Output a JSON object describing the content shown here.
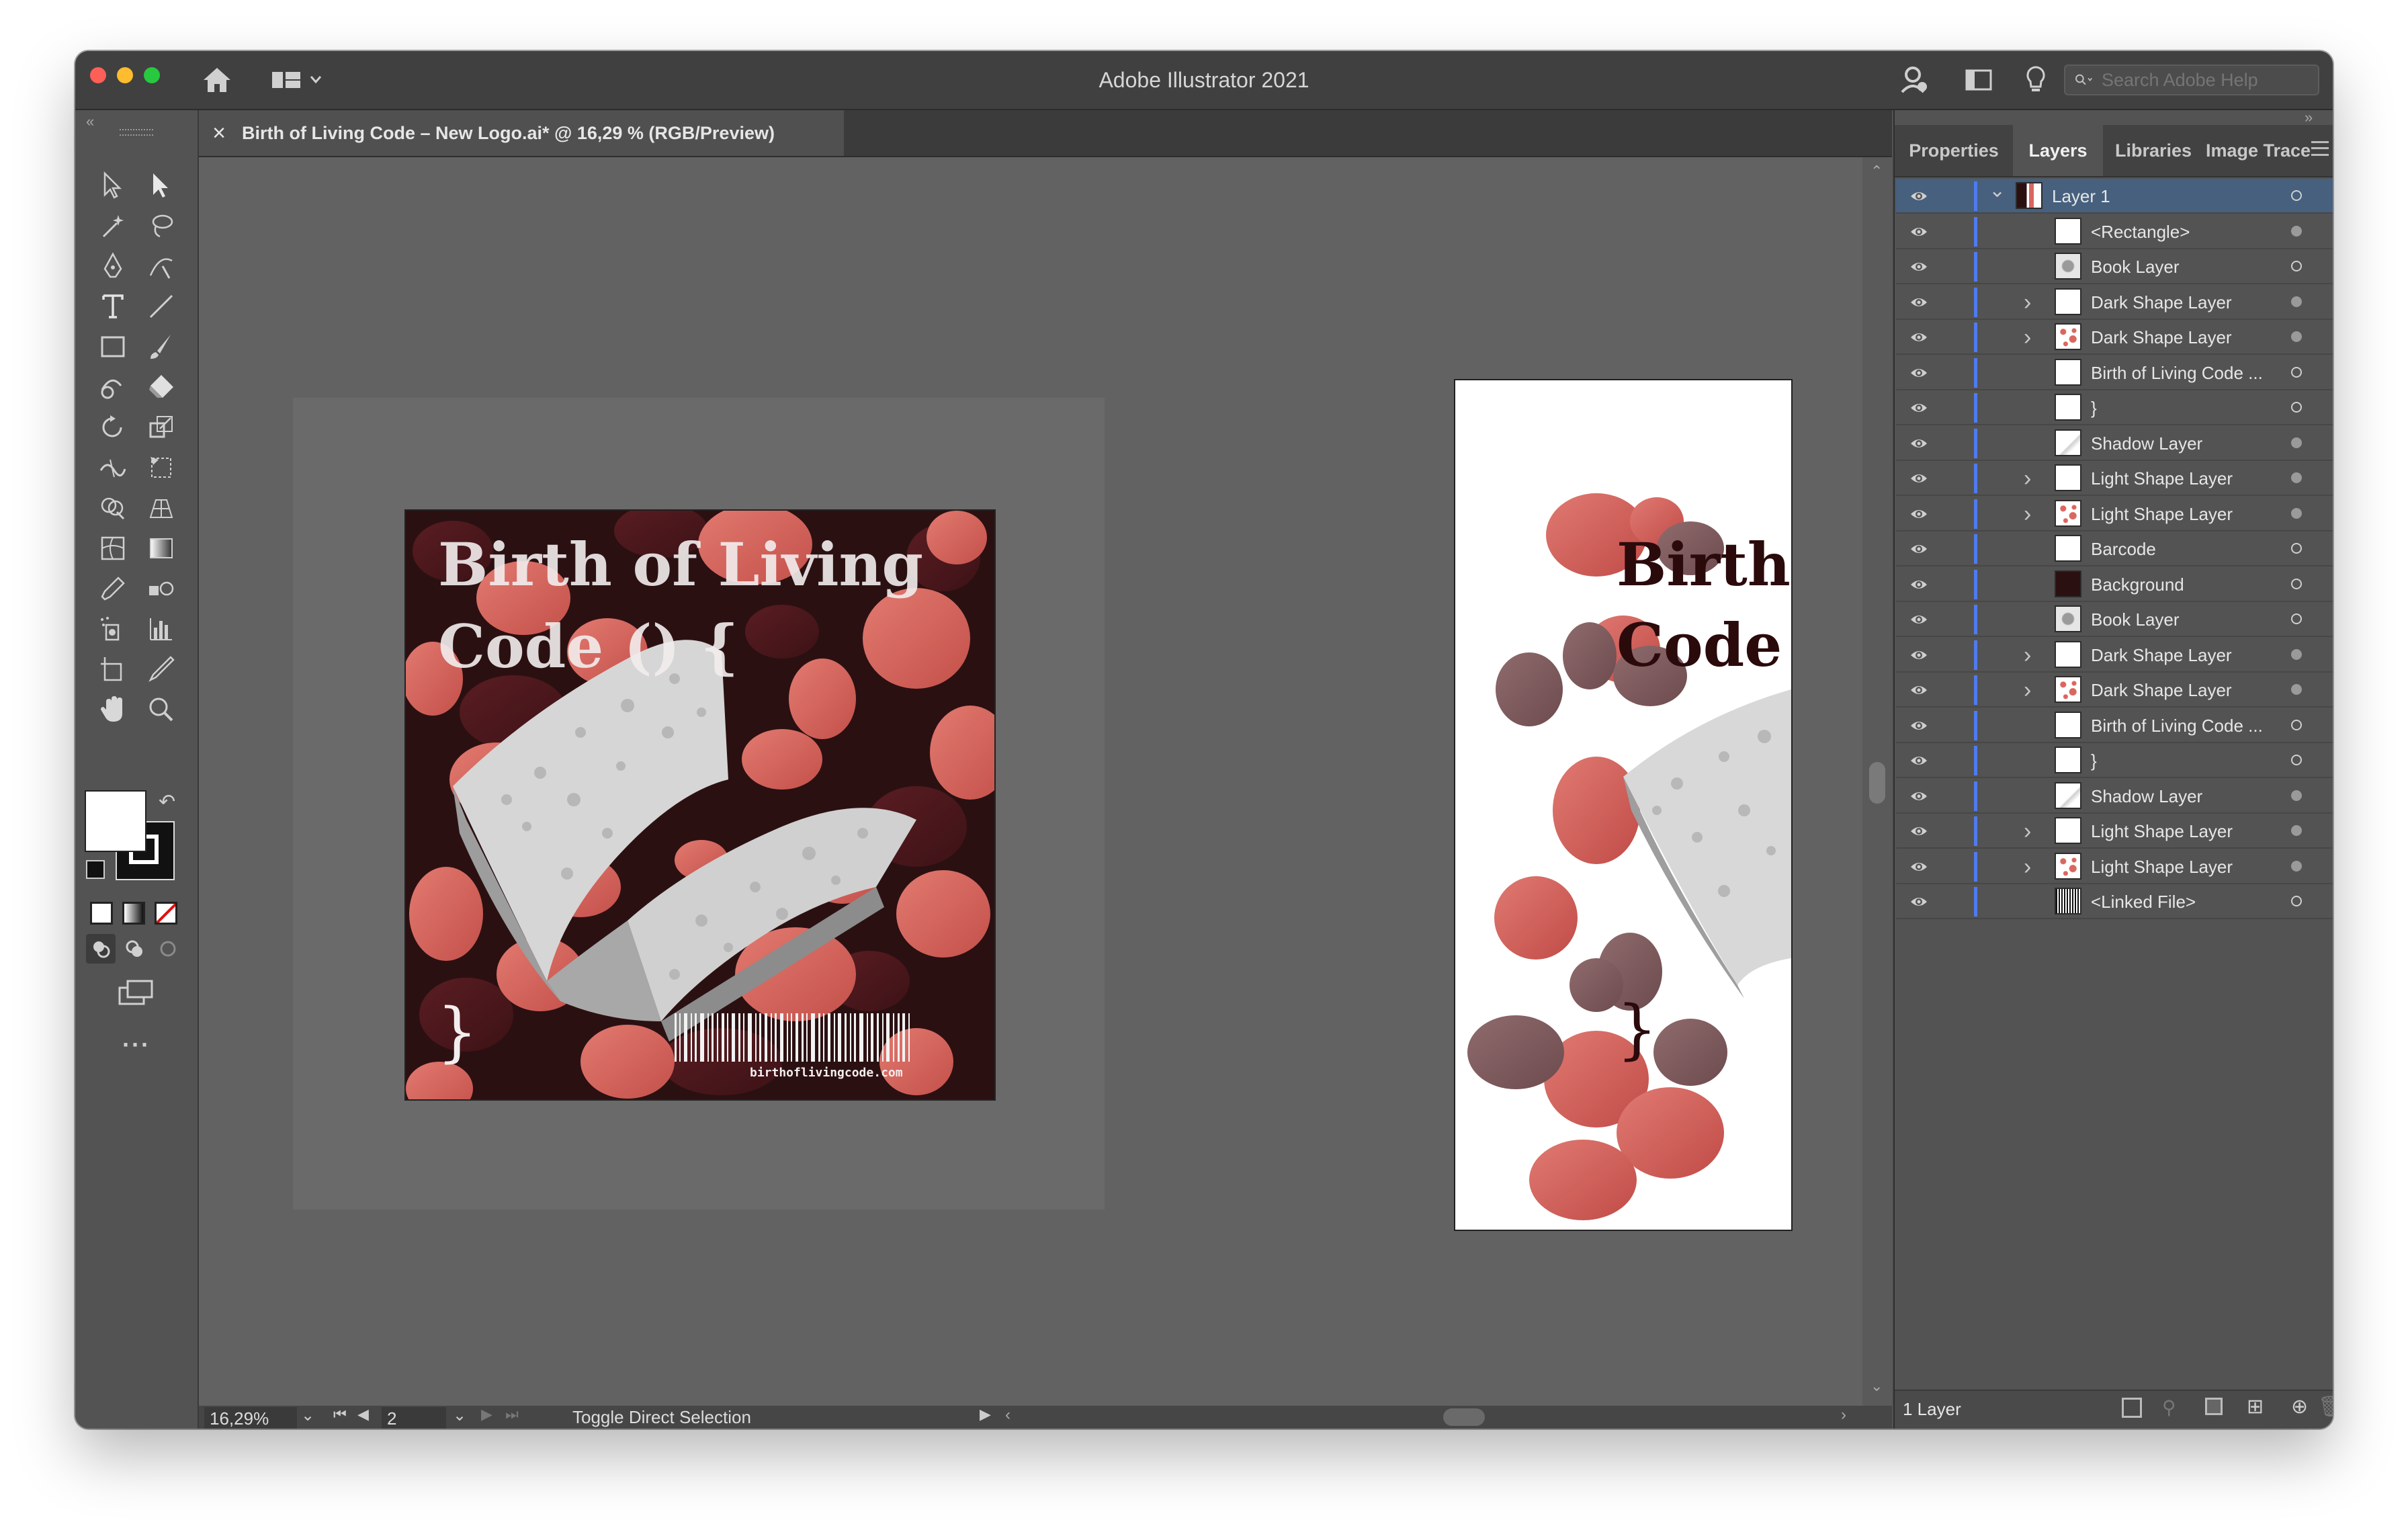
{
  "window": {
    "title": "Adobe Illustrator 2021",
    "traffic_colors": [
      "#fe5f57",
      "#febc2e",
      "#28c840"
    ]
  },
  "header": {
    "search_placeholder": "Search Adobe Help"
  },
  "document": {
    "tab_label": "Birth of Living Code – New Logo.ai* @ 16,29 % (RGB/Preview)",
    "close_glyph": "×"
  },
  "artboard1": {
    "headline_line1": "Birth of Living",
    "headline_line2": "Code () {",
    "brace": "}",
    "barcode_text": "birthoflivingcode.com",
    "bg_color": "#2b1012",
    "blob_color": "#d9675f"
  },
  "artboard2": {
    "headline_line1": "Birth",
    "headline_line2": "Code (",
    "brace": "}",
    "text_color": "#2b0a0c"
  },
  "status": {
    "zoom": "16,29%",
    "page": "2",
    "message": "Toggle Direct Selection"
  },
  "panel": {
    "tabs": [
      "Properties",
      "Layers",
      "Libraries",
      "Image Trace"
    ],
    "active_tab": "Layers",
    "footer_count": "1 Layer",
    "layers": [
      {
        "name": "Layer 1",
        "expander": "v",
        "thumb": "art",
        "target": "hollow"
      },
      {
        "name": "<Rectangle>",
        "expander": "",
        "thumb": "white",
        "target": "filled"
      },
      {
        "name": "Book Layer",
        "expander": "",
        "thumb": "book",
        "target": "hollow"
      },
      {
        "name": "Dark Shape Layer",
        "expander": ">",
        "thumb": "white",
        "target": "filled"
      },
      {
        "name": "Dark Shape Layer",
        "expander": ">",
        "thumb": "dots",
        "target": "filled"
      },
      {
        "name": "Birth of Living Code ...",
        "expander": "",
        "thumb": "white",
        "target": "hollow"
      },
      {
        "name": "}",
        "expander": "",
        "thumb": "white",
        "target": "hollow"
      },
      {
        "name": "Shadow Layer",
        "expander": "",
        "thumb": "shadow",
        "target": "filled"
      },
      {
        "name": "Light Shape Layer",
        "expander": ">",
        "thumb": "white",
        "target": "filled"
      },
      {
        "name": "Light Shape Layer",
        "expander": ">",
        "thumb": "dots",
        "target": "filled"
      },
      {
        "name": "Barcode",
        "expander": "",
        "thumb": "white",
        "target": "hollow"
      },
      {
        "name": "Background",
        "expander": "",
        "thumb": "dark",
        "target": "hollow"
      },
      {
        "name": "Book Layer",
        "expander": "",
        "thumb": "book",
        "target": "hollow"
      },
      {
        "name": "Dark Shape Layer",
        "expander": ">",
        "thumb": "white",
        "target": "filled"
      },
      {
        "name": "Dark Shape Layer",
        "expander": ">",
        "thumb": "dots",
        "target": "filled"
      },
      {
        "name": "Birth of Living Code ...",
        "expander": "",
        "thumb": "white",
        "target": "hollow"
      },
      {
        "name": "}",
        "expander": "",
        "thumb": "white",
        "target": "hollow"
      },
      {
        "name": "Shadow Layer",
        "expander": "",
        "thumb": "shadow",
        "target": "filled"
      },
      {
        "name": "Light Shape Layer",
        "expander": ">",
        "thumb": "white",
        "target": "filled"
      },
      {
        "name": "Light Shape Layer",
        "expander": ">",
        "thumb": "dots",
        "target": "filled"
      },
      {
        "name": "<Linked File>",
        "expander": "",
        "thumb": "barcode",
        "target": "hollow"
      }
    ]
  },
  "tools": [
    "selection-tool",
    "direct-selection-tool",
    "magic-wand-tool",
    "lasso-tool",
    "pen-tool",
    "curvature-tool",
    "type-tool",
    "line-segment-tool",
    "rectangle-tool",
    "paintbrush-tool",
    "shaper-tool",
    "eraser-tool",
    "rotate-tool",
    "scale-tool",
    "width-tool",
    "free-transform-tool",
    "shape-builder-tool",
    "perspective-grid-tool",
    "mesh-tool",
    "gradient-tool",
    "eyedropper-tool",
    "blend-tool",
    "symbol-sprayer-tool",
    "column-graph-tool",
    "artboard-tool",
    "slice-tool",
    "hand-tool",
    "zoom-tool"
  ]
}
